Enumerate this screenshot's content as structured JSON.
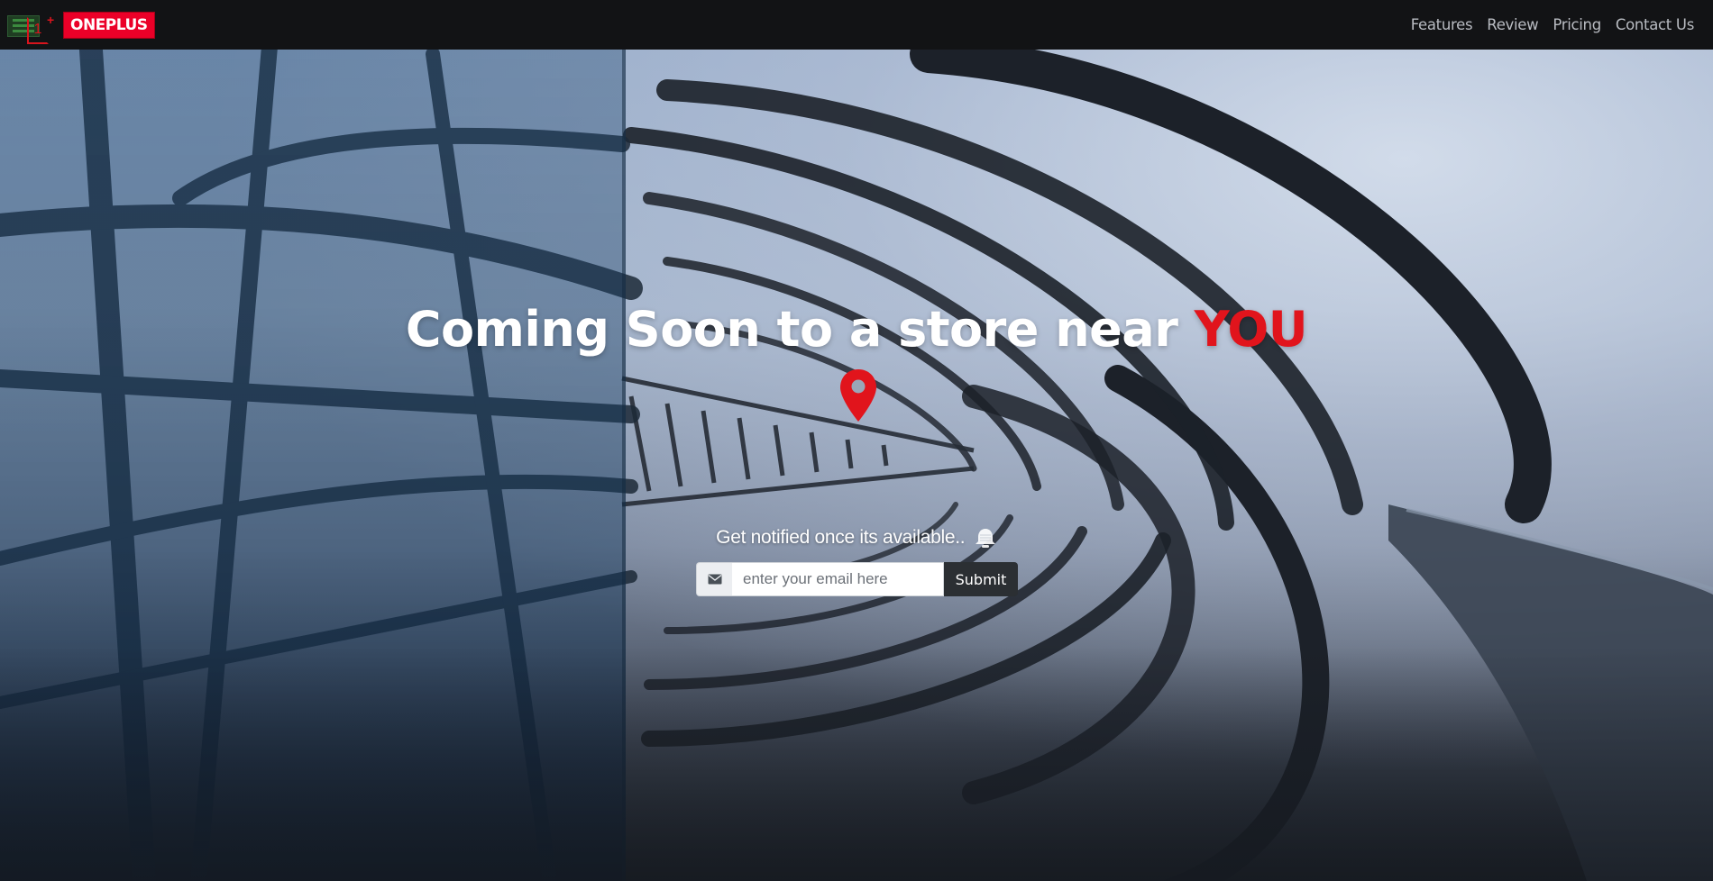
{
  "navbar": {
    "brand": {
      "logo_icon": "oneplus-logo-icon",
      "text": "ONEPLUS",
      "accent_color": "#eb0028"
    },
    "links": [
      {
        "label": "Features"
      },
      {
        "label": "Review"
      },
      {
        "label": "Pricing"
      },
      {
        "label": "Contact Us"
      }
    ]
  },
  "hero": {
    "headline_prefix": "Coming Soon to a store near ",
    "headline_accent": "YOU",
    "accent_color": "#e1141c",
    "pin_icon": "map-marker-icon",
    "notify_text": "Get notified once its available..",
    "notify_icon": "bell-icon",
    "signup": {
      "icon": "envelope-icon",
      "email_placeholder": "enter your email here",
      "email_value": "",
      "submit_label": "Submit"
    }
  }
}
